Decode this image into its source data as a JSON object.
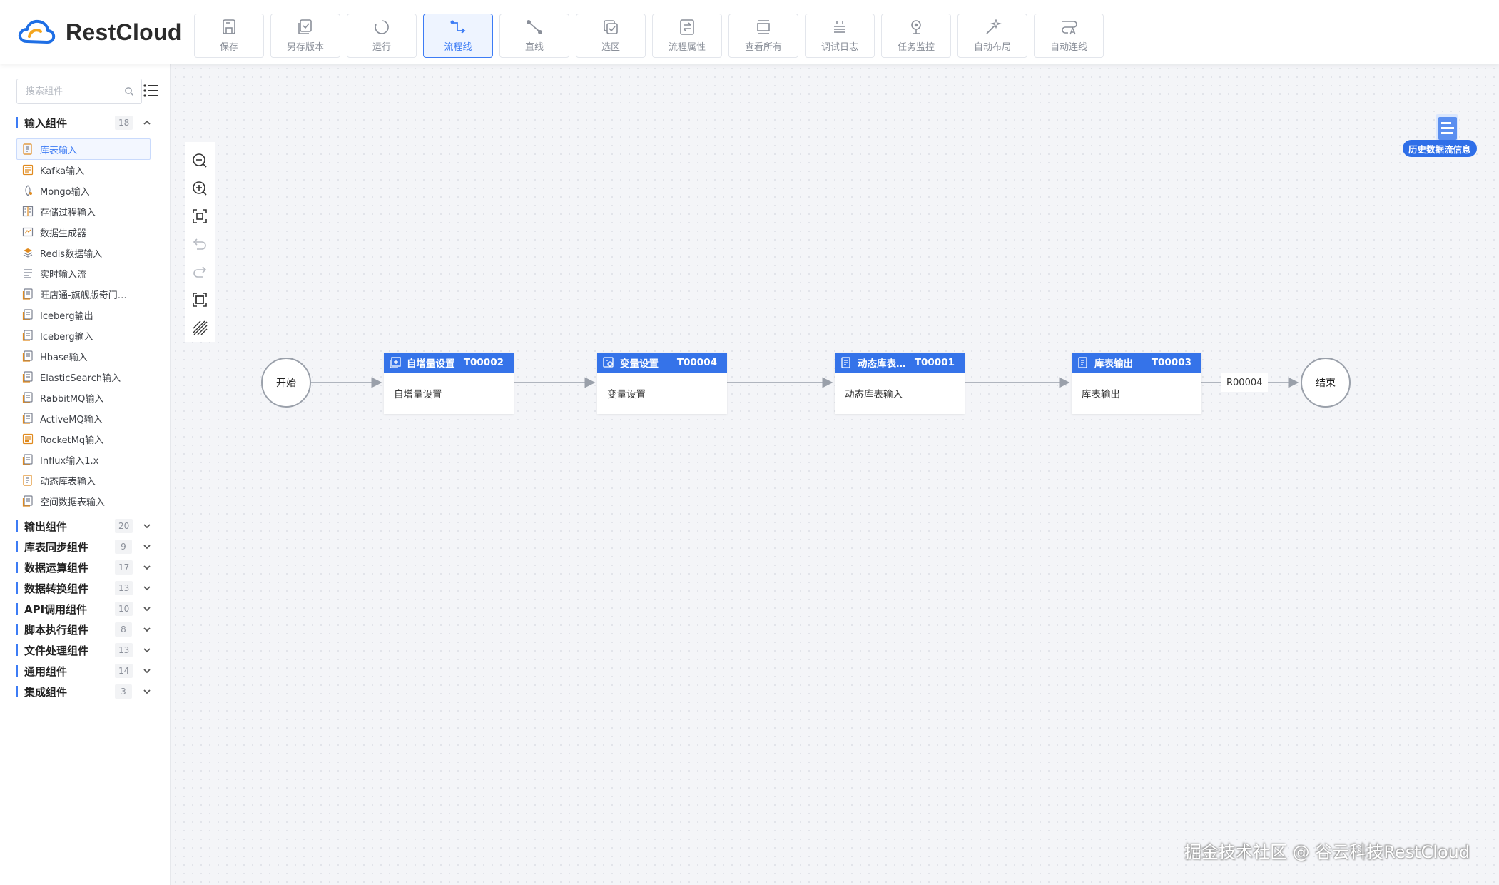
{
  "app": {
    "name": "RestCloud"
  },
  "toolbar": {
    "buttons": [
      {
        "label": "保存",
        "icon": "save-icon"
      },
      {
        "label": "另存版本",
        "icon": "save-version-icon"
      },
      {
        "label": "运行",
        "icon": "run-icon"
      },
      {
        "label": "流程线",
        "icon": "flow-line-icon",
        "active": true
      },
      {
        "label": "直线",
        "icon": "straight-line-icon"
      },
      {
        "label": "选区",
        "icon": "select-area-icon"
      },
      {
        "label": "流程属性",
        "icon": "flow-properties-icon"
      },
      {
        "label": "查看所有",
        "icon": "view-all-icon"
      },
      {
        "label": "调试日志",
        "icon": "debug-log-icon"
      },
      {
        "label": "任务监控",
        "icon": "task-monitor-icon"
      },
      {
        "label": "自动布局",
        "icon": "auto-layout-icon"
      },
      {
        "label": "自动连线",
        "icon": "auto-connect-icon"
      }
    ]
  },
  "sidebar": {
    "search": {
      "placeholder": "搜索组件",
      "value": ""
    },
    "input_group": {
      "title": "输入组件",
      "count": "18",
      "expanded": true,
      "items": [
        {
          "label": "库表输入",
          "icon": "table-input-icon",
          "selected": true
        },
        {
          "label": "Kafka输入",
          "icon": "kafka-icon"
        },
        {
          "label": "Mongo输入",
          "icon": "mongo-icon"
        },
        {
          "label": "存储过程输入",
          "icon": "procedure-icon"
        },
        {
          "label": "数据生成器",
          "icon": "data-generator-icon"
        },
        {
          "label": "Redis数据输入",
          "icon": "redis-icon"
        },
        {
          "label": "实时输入流",
          "icon": "stream-icon"
        },
        {
          "label": "旺店通-旗舰版奇门…",
          "icon": "document-icon"
        },
        {
          "label": "Iceberg输出",
          "icon": "document-icon"
        },
        {
          "label": "Iceberg输入",
          "icon": "document-icon"
        },
        {
          "label": "Hbase输入",
          "icon": "document-icon"
        },
        {
          "label": "ElasticSearch输入",
          "icon": "document-icon"
        },
        {
          "label": "RabbitMQ输入",
          "icon": "document-icon"
        },
        {
          "label": "ActiveMQ输入",
          "icon": "document-icon"
        },
        {
          "label": "RocketMq输入",
          "icon": "rocketmq-icon"
        },
        {
          "label": "Influx输入1.x",
          "icon": "document-icon"
        },
        {
          "label": "动态库表输入",
          "icon": "table-input-icon"
        },
        {
          "label": "空间数据表输入",
          "icon": "document-icon"
        }
      ]
    },
    "groups": [
      {
        "title": "输出组件",
        "count": "20"
      },
      {
        "title": "库表同步组件",
        "count": "9"
      },
      {
        "title": "数据运算组件",
        "count": "17"
      },
      {
        "title": "数据转换组件",
        "count": "13"
      },
      {
        "title": "API调用组件",
        "count": "10"
      },
      {
        "title": "脚本执行组件",
        "count": "8"
      },
      {
        "title": "文件处理组件",
        "count": "13"
      },
      {
        "title": "通用组件",
        "count": "14"
      },
      {
        "title": "集成组件",
        "count": "3"
      }
    ]
  },
  "canvas": {
    "history_label": "历史数据流信息",
    "start_label": "开始",
    "end_label": "结束",
    "nodes": [
      {
        "title": "自增量设置",
        "code": "T00002",
        "body": "自增量设置",
        "icon": "increment-icon"
      },
      {
        "title": "变量设置",
        "code": "T00004",
        "body": "变量设置",
        "icon": "variable-icon"
      },
      {
        "title": "动态库表…",
        "code": "T00001",
        "body": "动态库表输入",
        "icon": "table-input-icon"
      },
      {
        "title": "库表输出",
        "code": "T00003",
        "body": "库表输出",
        "icon": "table-output-icon"
      }
    ],
    "edge_label": "R00004",
    "watermark": "掘金技术社区 @ 谷云科技RestCloud"
  },
  "colors": {
    "accent": "#3d7cf5",
    "node_header": "#3573e9",
    "canvas_bg": "#f4f5f8"
  }
}
